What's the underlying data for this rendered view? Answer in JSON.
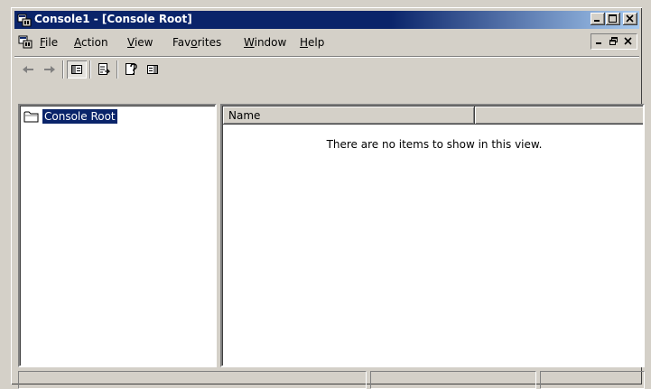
{
  "window": {
    "title": "Console1 - [Console Root]",
    "colors": {
      "titlebar": "#0a246a",
      "face": "#d4d0c8",
      "selection": "#0a246a"
    }
  },
  "menu": {
    "items": [
      {
        "label": "File",
        "accel": "F"
      },
      {
        "label": "Action",
        "accel": "A"
      },
      {
        "label": "View",
        "accel": "V"
      },
      {
        "label": "Favorites",
        "accel": "o"
      },
      {
        "label": "Window",
        "accel": "W"
      },
      {
        "label": "Help",
        "accel": "H"
      }
    ]
  },
  "toolbar": {
    "buttons": [
      "back-icon",
      "forward-icon",
      "show-hide-tree-icon",
      "export-list-icon",
      "help-icon",
      "show-hide-action-pane-icon"
    ]
  },
  "tree": {
    "root_label": "Console Root"
  },
  "list": {
    "columns": [
      "Name",
      ""
    ],
    "empty_message": "There are no items to show in this view."
  },
  "status": {
    "cells": [
      "",
      "",
      ""
    ]
  }
}
